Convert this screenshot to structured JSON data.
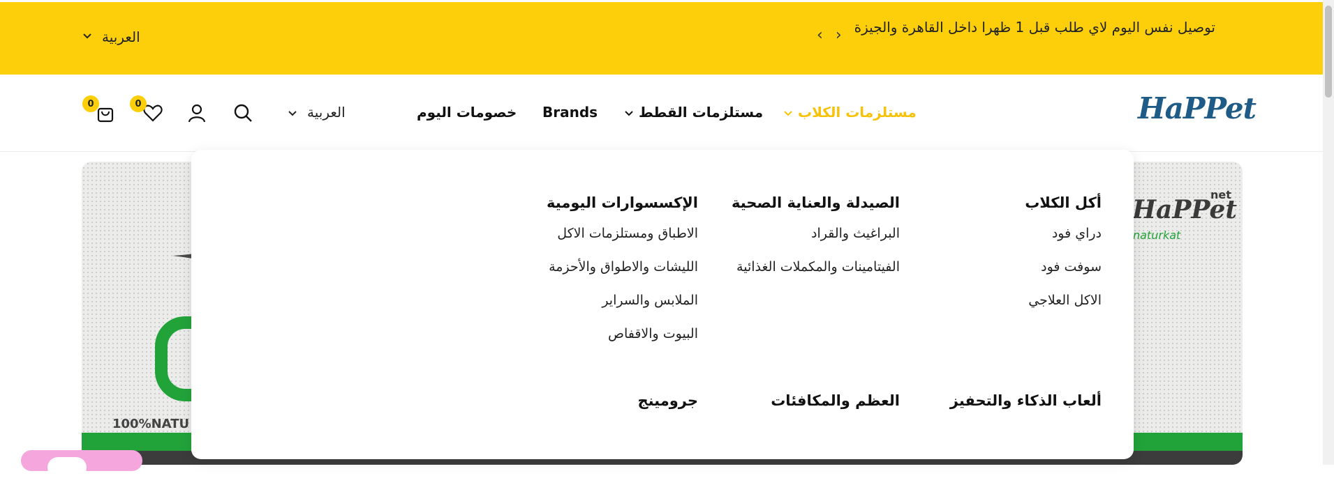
{
  "announcement": {
    "text": "توصيل نفس اليوم لاي طلب قبل 1 ظهرا داخل القاهرة والجيزة",
    "language": "العربية"
  },
  "header": {
    "logo": "HaPPet",
    "nav": [
      "مستلزمات الكلاب",
      "مستلزمات القطط",
      "Brands",
      "خصومات اليوم"
    ],
    "language": "العربية",
    "wishlist_count": "0",
    "cart_count": "0"
  },
  "mega_menu": {
    "col1": {
      "title": "أكل الكلاب",
      "items": [
        "دراي فود",
        "سوفت فود",
        "الاكل العلاجي"
      ]
    },
    "col2": {
      "title": "الصيدلة والعناية الصحية",
      "items": [
        "البراغيث والقراد",
        "الفيتامينات والمكملات الغذائية"
      ]
    },
    "col3": {
      "title": "الإكسسوارات اليومية",
      "items": [
        "الاطباق ومستلزمات الاكل",
        "الليشات والاطواق والأحزمة",
        "الملابس والسراير",
        "البيوت والاقفاص"
      ]
    },
    "row2": [
      "ألعاب الذكاء والتحفيز",
      "العظم والمكافئات",
      "جرومينج"
    ]
  },
  "hero": {
    "text": "100%NATU",
    "logo": "HaPPet",
    "logo_suffix": "net",
    "sub": "naturkat"
  },
  "colors": {
    "accent": "#fccf0a",
    "brand": "#1e5b86",
    "green": "#22a33a"
  },
  "icons": [
    "chevron-left-icon",
    "chevron-right-icon",
    "chevron-down-icon",
    "search-icon",
    "user-icon",
    "heart-icon",
    "cart-icon"
  ]
}
